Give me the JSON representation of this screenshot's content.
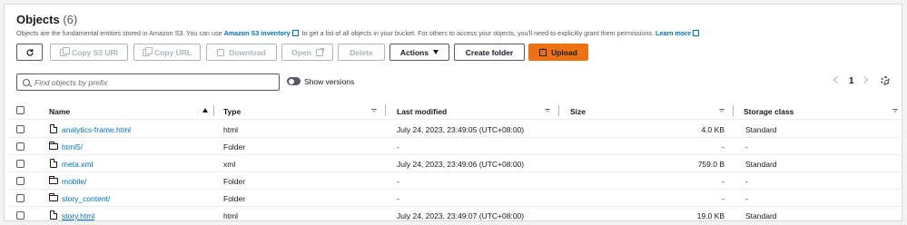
{
  "header": {
    "title": "Objects",
    "count": "(6)",
    "desc_before": "Objects are the fundamental entities stored in Amazon S3. You can use",
    "inventory_link": "Amazon S3 inventory",
    "desc_middle": "to get a list of all objects in your bucket. For others to access your objects, you'll need to explicitly grant them permissions.",
    "learn_more": "Learn more"
  },
  "toolbar": {
    "copy_uri": "Copy S3 URI",
    "copy_url": "Copy URL",
    "download": "Download",
    "open": "Open",
    "delete": "Delete",
    "actions": "Actions",
    "create_folder": "Create folder",
    "upload": "Upload"
  },
  "search": {
    "placeholder": "Find objects by prefix",
    "value": ""
  },
  "versions": {
    "label": "Show versions",
    "enabled": false
  },
  "pagination": {
    "page": "1"
  },
  "colors": {
    "accent": "#ec7211",
    "link": "#0073bb",
    "text": "#16191f",
    "muted": "#545b64"
  },
  "table": {
    "columns": [
      "Name",
      "Type",
      "Last modified",
      "Size",
      "Storage class"
    ],
    "rows": [
      {
        "name": "analytics-frame.html",
        "kind": "file",
        "type": "html",
        "modified": "July 24, 2023, 23:49:05 (UTC+08:00)",
        "size": "4.0 KB",
        "storage": "Standard"
      },
      {
        "name": "html5/",
        "kind": "folder",
        "type": "Folder",
        "modified": "-",
        "size": "-",
        "storage": "-"
      },
      {
        "name": "meta.xml",
        "kind": "file",
        "type": "xml",
        "modified": "July 24, 2023, 23:49:06 (UTC+08:00)",
        "size": "759.0 B",
        "storage": "Standard"
      },
      {
        "name": "mobile/",
        "kind": "folder",
        "type": "Folder",
        "modified": "-",
        "size": "-",
        "storage": "-"
      },
      {
        "name": "story_content/",
        "kind": "folder",
        "type": "Folder",
        "modified": "-",
        "size": "-",
        "storage": "-"
      },
      {
        "name": "story.html",
        "kind": "file",
        "type": "html",
        "modified": "July 24, 2023, 23:49:07 (UTC+08:00)",
        "size": "19.0 KB",
        "storage": "Standard"
      }
    ]
  }
}
